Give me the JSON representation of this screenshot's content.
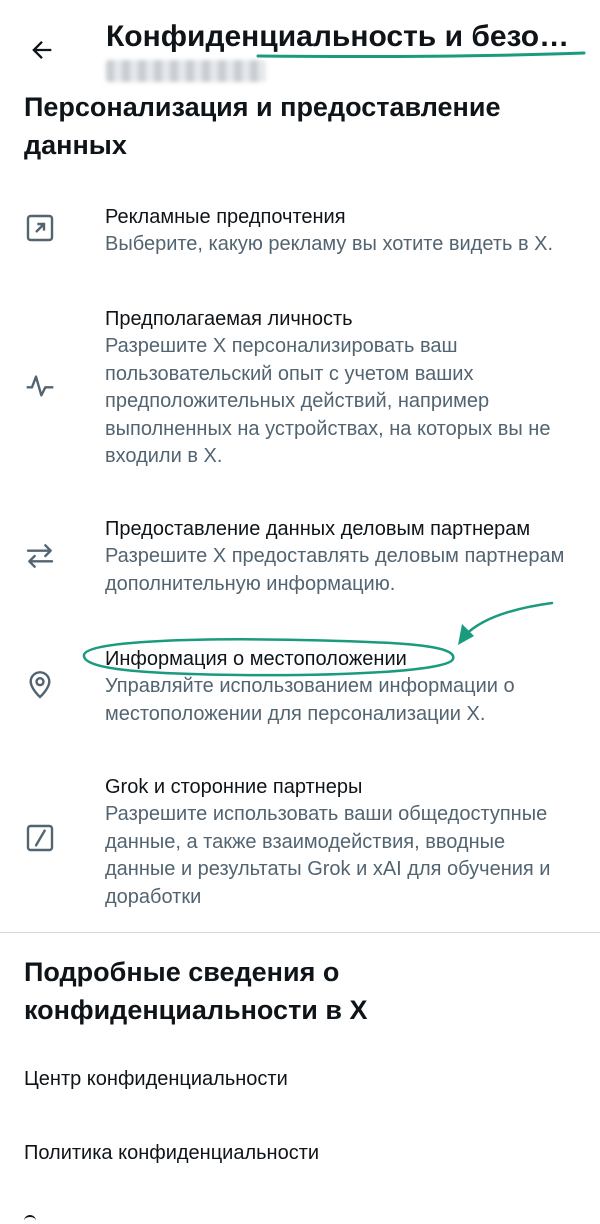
{
  "header": {
    "title": "Конфиденциальность и безопас…",
    "back_icon": "arrow-left-icon"
  },
  "personalization": {
    "title": "Персонализация и предоставление данных",
    "items": [
      {
        "icon": "external-box-icon",
        "title": "Рекламные предпочтения",
        "desc": "Выберите, какую рекламу вы хотите видеть в X."
      },
      {
        "icon": "activity-icon",
        "title": "Предполагаемая личность",
        "desc": "Разрешите X персонализировать ваш пользовательский опыт с учетом ваших предположительных действий, например выполненных на устройствах, на которых вы не входили в X."
      },
      {
        "icon": "swap-arrows-icon",
        "title": "Предоставление данных деловым партнерам",
        "desc": "Разрешите X предоставлять деловым партнерам дополнительную информацию."
      },
      {
        "icon": "location-pin-icon",
        "title": "Информация о местоположении",
        "desc": "Управляйте использованием информации о местоположении для персонализации X."
      },
      {
        "icon": "grok-icon",
        "title": "Grok и сторонние партнеры",
        "desc": "Разрешите использовать ваши общедоступные данные, а также взаимодействия, вводные данные и результаты Grok и xAI для обучения и доработки"
      }
    ]
  },
  "privacy_info": {
    "title": "Подробные сведения о конфиденциальности в X",
    "links": [
      "Центр конфиденциальности",
      "Политика конфиденциальности"
    ]
  },
  "colors": {
    "text": "#0f1419",
    "secondary": "#536471",
    "annotation": "#1a9b7e"
  }
}
